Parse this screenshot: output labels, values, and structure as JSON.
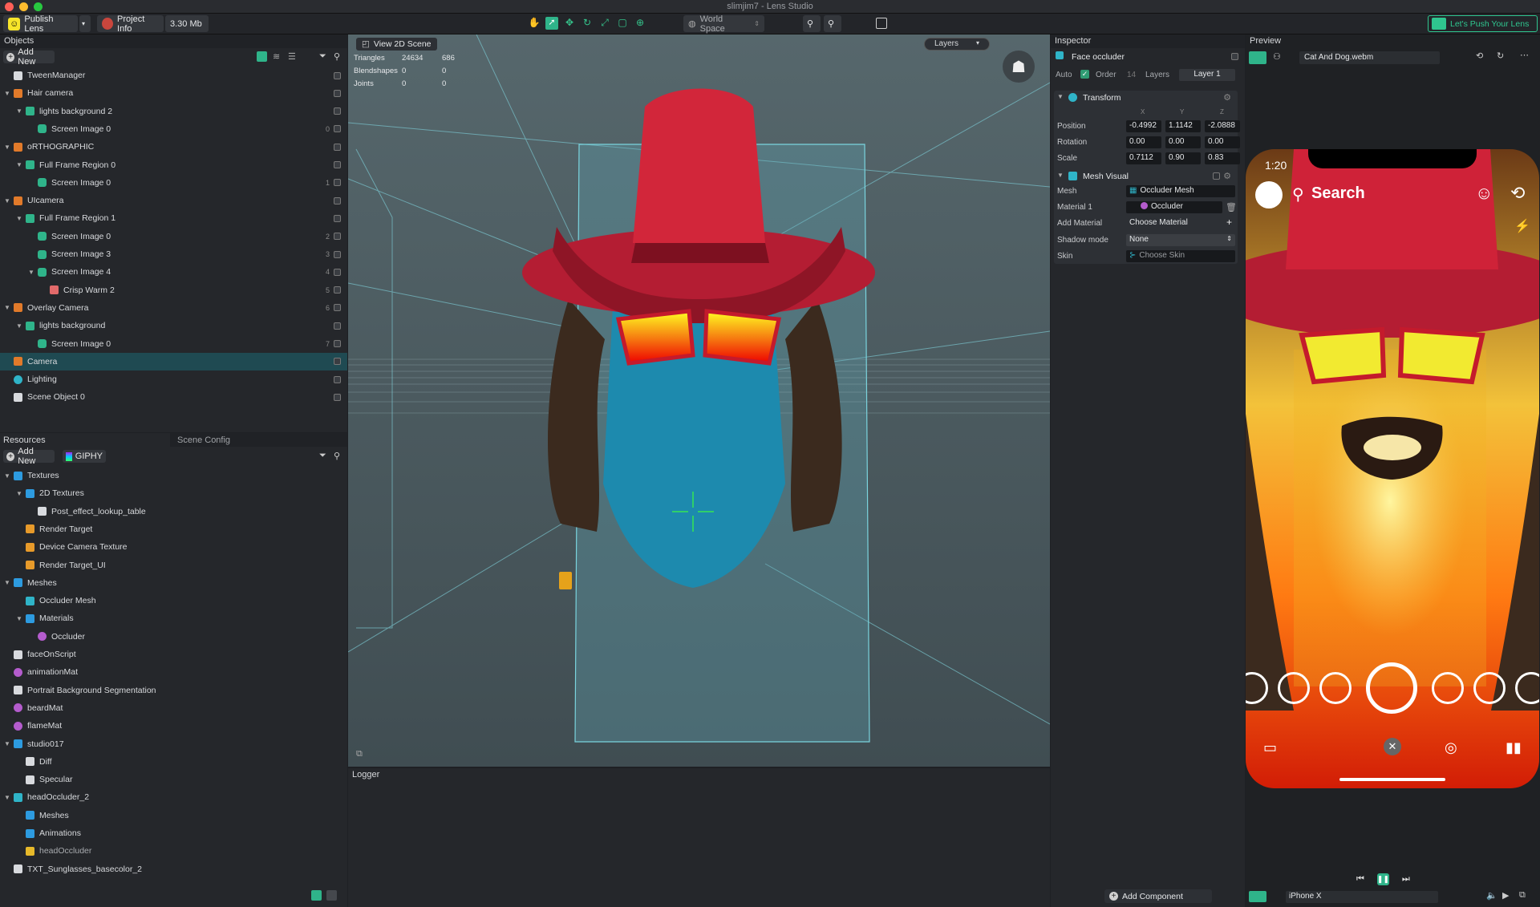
{
  "window": {
    "title": "slimjim7 - Lens Studio"
  },
  "toolbar": {
    "publish": "Publish Lens",
    "project_info": "Project Info",
    "size": "3.30 Mb",
    "space": "World Space",
    "promo": "Let's Push Your Lens"
  },
  "objects": {
    "title": "Objects",
    "add_new": "Add New",
    "items": [
      {
        "label": "TweenManager",
        "depth": 0,
        "icon": "object",
        "layer": ""
      },
      {
        "label": "Hair camera",
        "depth": 0,
        "icon": "camera",
        "layer": ""
      },
      {
        "label": "lights background 2",
        "depth": 1,
        "icon": "orthographic",
        "layer": ""
      },
      {
        "label": "Screen Image 0",
        "depth": 2,
        "icon": "image",
        "layer": "0"
      },
      {
        "label": "oRTHOGRAPHIC",
        "depth": 0,
        "icon": "camera",
        "layer": ""
      },
      {
        "label": "Full Frame Region 0",
        "depth": 1,
        "icon": "orthographic",
        "layer": ""
      },
      {
        "label": "Screen Image 0",
        "depth": 2,
        "icon": "image",
        "layer": "1"
      },
      {
        "label": "UIcamera",
        "depth": 0,
        "icon": "camera",
        "layer": ""
      },
      {
        "label": "Full Frame Region 1",
        "depth": 1,
        "icon": "orthographic",
        "layer": ""
      },
      {
        "label": "Screen Image 0",
        "depth": 2,
        "icon": "image",
        "layer": "2"
      },
      {
        "label": "Screen Image 3",
        "depth": 2,
        "icon": "image",
        "layer": "3"
      },
      {
        "label": "Screen Image 4",
        "depth": 2,
        "icon": "image",
        "layer": "4"
      },
      {
        "label": "Crisp Warm 2",
        "depth": 3,
        "icon": "postfx",
        "layer": "5"
      },
      {
        "label": "Overlay Camera",
        "depth": 0,
        "icon": "camera",
        "layer": "6"
      },
      {
        "label": "lights background",
        "depth": 1,
        "icon": "orthographic",
        "layer": ""
      },
      {
        "label": "Screen Image 0",
        "depth": 2,
        "icon": "image",
        "layer": "7"
      },
      {
        "label": "Camera",
        "depth": 0,
        "icon": "camera",
        "layer": ""
      },
      {
        "label": "Lighting",
        "depth": 0,
        "icon": "light",
        "layer": ""
      },
      {
        "label": "Scene Object 0",
        "depth": 0,
        "icon": "object",
        "layer": ""
      }
    ]
  },
  "resources": {
    "tab1": "Resources",
    "tab2": "Scene Config",
    "add_new": "Add New",
    "giphy": "GIPHY",
    "items": [
      {
        "label": "Textures",
        "depth": 0,
        "icon": "folder"
      },
      {
        "label": "2D Textures",
        "depth": 1,
        "icon": "folder"
      },
      {
        "label": "Post_effect_lookup_table",
        "depth": 2,
        "icon": "texture"
      },
      {
        "label": "Render Target",
        "depth": 1,
        "icon": "render"
      },
      {
        "label": "Device Camera Texture",
        "depth": 1,
        "icon": "render"
      },
      {
        "label": "Render Target_UI",
        "depth": 1,
        "icon": "render"
      },
      {
        "label": "Meshes",
        "depth": 0,
        "icon": "folder"
      },
      {
        "label": "Occluder Mesh",
        "depth": 1,
        "icon": "mesh"
      },
      {
        "label": "Materials",
        "depth": 1,
        "icon": "folder"
      },
      {
        "label": "Occluder",
        "depth": 2,
        "icon": "material"
      },
      {
        "label": "faceOnScript",
        "depth": 0,
        "icon": "script"
      },
      {
        "label": "animationMat",
        "depth": 0,
        "icon": "material"
      },
      {
        "label": "Portrait Background Segmentation",
        "depth": 0,
        "icon": "segment"
      },
      {
        "label": "beardMat",
        "depth": 0,
        "icon": "material"
      },
      {
        "label": "flameMat",
        "depth": 0,
        "icon": "material"
      },
      {
        "label": "studio017",
        "depth": 0,
        "icon": "folder"
      },
      {
        "label": "Diff",
        "depth": 1,
        "icon": "texture"
      },
      {
        "label": "Specular",
        "depth": 1,
        "icon": "texture"
      },
      {
        "label": "headOccluder_2",
        "depth": 0,
        "icon": "folder2"
      },
      {
        "label": "Meshes",
        "depth": 1,
        "icon": "folder"
      },
      {
        "label": "Animations",
        "depth": 1,
        "icon": "folder"
      },
      {
        "label": "headOccluder",
        "depth": 1,
        "icon": "prefab"
      },
      {
        "label": "TXT_Sunglasses_basecolor_2",
        "depth": 0,
        "icon": "texture"
      }
    ]
  },
  "scene": {
    "view2d": "View 2D Scene",
    "layers": "Layers",
    "stats": [
      {
        "label": "Triangles",
        "a": "24634",
        "b": "686"
      },
      {
        "label": "Blendshapes",
        "a": "0",
        "b": "0"
      },
      {
        "label": "Joints",
        "a": "0",
        "b": "0"
      }
    ]
  },
  "logger": {
    "title": "Logger"
  },
  "inspector": {
    "title": "Inspector",
    "object": "Face occluder",
    "auto": "Auto",
    "order": "Order",
    "order_val": "14",
    "layers": "Layers",
    "layer_val": "Layer 1",
    "transform": {
      "title": "Transform",
      "x": "X",
      "y": "Y",
      "z": "Z",
      "position": "Position",
      "rotation": "Rotation",
      "scale": "Scale",
      "pos": [
        "-0.4992",
        "1.1142",
        "-2.0888"
      ],
      "rot": [
        "0.00",
        "0.00",
        "0.00"
      ],
      "scl": [
        "0.7112",
        "0.90",
        "0.83"
      ]
    },
    "mesh_visual": {
      "title": "Mesh Visual",
      "mesh": "Mesh",
      "mesh_val": "Occluder Mesh",
      "material": "Material 1",
      "material_val": "Occluder",
      "add_material": "Add Material",
      "choose_material": "Choose Material",
      "shadow": "Shadow mode",
      "shadow_val": "None",
      "skin": "Skin",
      "skin_val": "Choose Skin"
    },
    "add_component": "Add Component"
  },
  "preview": {
    "title": "Preview",
    "video": "Cat And Dog.webm",
    "time": "1:20",
    "search": "Search",
    "device": "iPhone X"
  }
}
